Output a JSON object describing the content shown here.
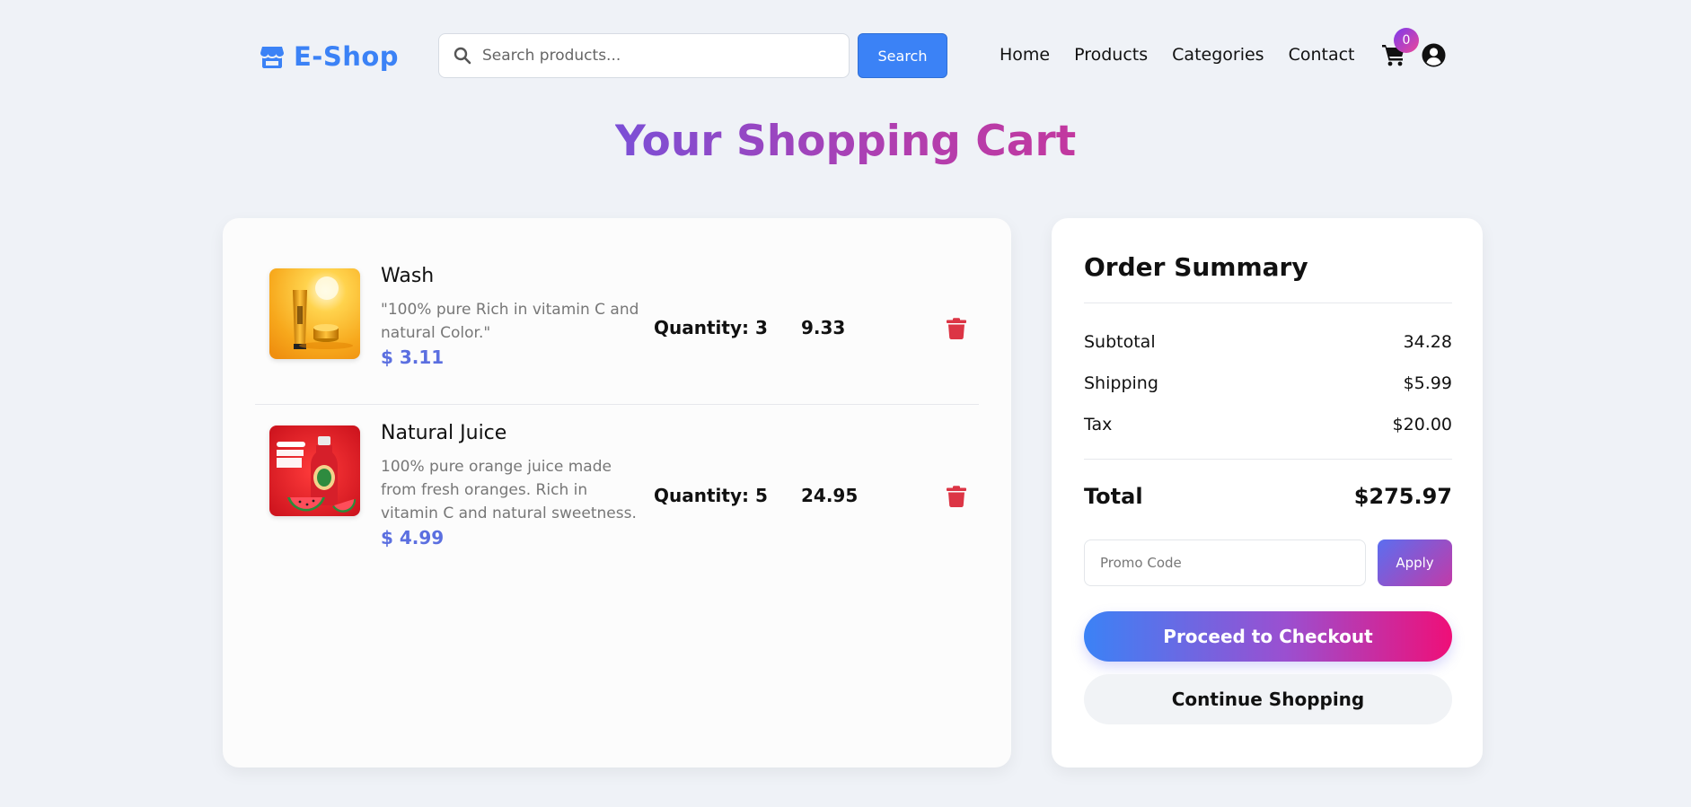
{
  "header": {
    "logo_text": "E-Shop",
    "search": {
      "placeholder": "Search products...",
      "button_label": "Search"
    },
    "nav": [
      "Home",
      "Products",
      "Categories",
      "Contact"
    ],
    "cart_count": "0"
  },
  "page_title": "Your Shopping Cart",
  "cart": {
    "items": [
      {
        "name": "Wash",
        "description": "\"100% pure Rich in vitamin C and natural Color.\"",
        "unit_price": "$ 3.11",
        "quantity": "Quantity: 3",
        "line_total": "9.33"
      },
      {
        "name": "Natural Juice",
        "description": "100% pure orange juice made from fresh oranges. Rich in vitamin C and natural sweetness.",
        "unit_price": "$ 4.99",
        "quantity": "Quantity: 5",
        "line_total": "24.95"
      }
    ]
  },
  "summary": {
    "title": "Order Summary",
    "subtotal_label": "Subtotal",
    "subtotal_value": "34.28",
    "shipping_label": "Shipping",
    "shipping_value": "$5.99",
    "tax_label": "Tax",
    "tax_value": "$20.00",
    "total_label": "Total",
    "total_value": "$275.97",
    "promo_placeholder": "Promo Code",
    "apply_label": "Apply",
    "checkout_label": "Proceed to Checkout",
    "continue_label": "Continue Shopping"
  },
  "colors": {
    "accent": "#3b82f6",
    "price": "#5b6fe0",
    "delete": "#dc3545",
    "background": "#eff2f7"
  },
  "icons": [
    "store-icon",
    "search-icon",
    "cart-icon",
    "user-circle-icon",
    "trash-icon"
  ]
}
